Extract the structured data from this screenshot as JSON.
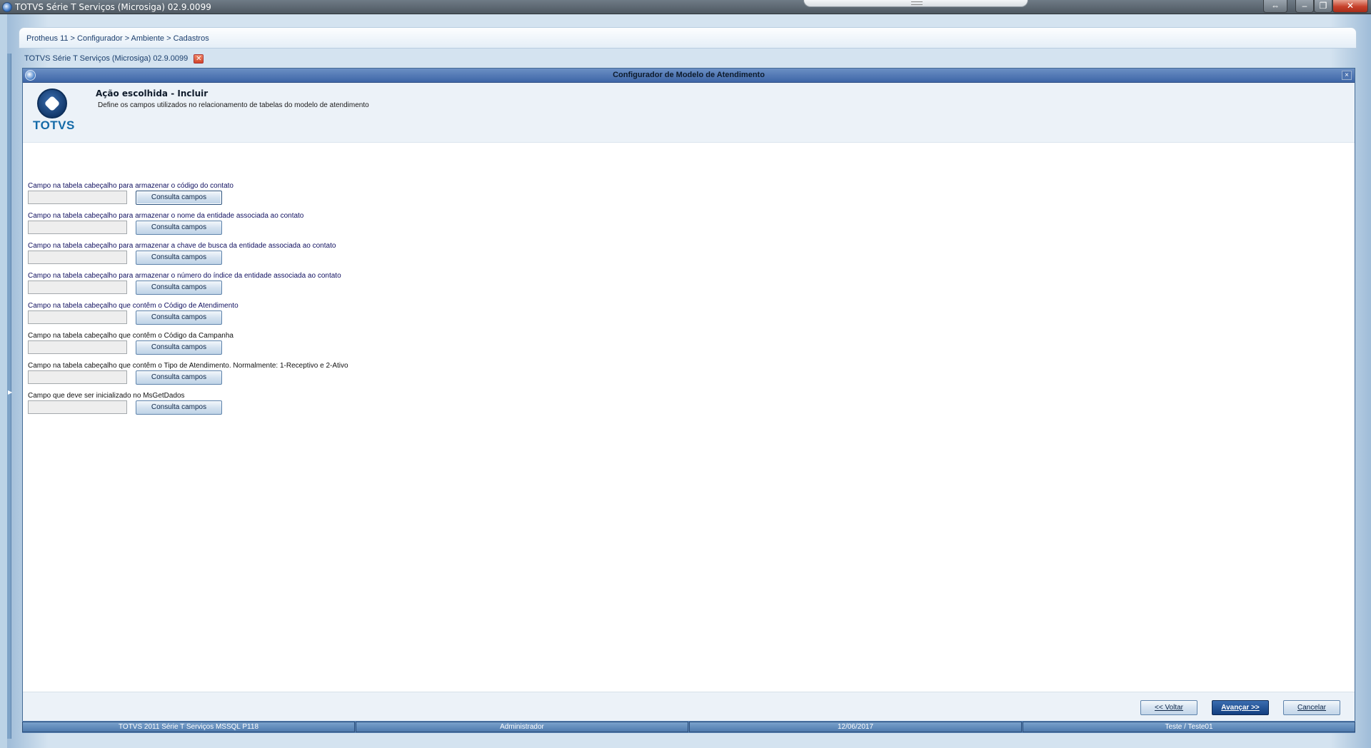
{
  "window": {
    "title": "TOTVS Série T Serviços (Microsiga) 02.9.0099"
  },
  "breadcrumb": "Protheus 11 > Configurador > Ambiente > Cadastros",
  "tab": {
    "label": "TOTVS Série T Serviços (Microsiga) 02.9.0099",
    "close_glyph": "✕"
  },
  "dialog": {
    "title": "Configurador de Modelo de Atendimento",
    "close_glyph": "×",
    "header_title": "Ação escolhida - Incluir",
    "header_subtitle": "Define os campos utilizados no relacionamento de tabelas do modelo de atendimento",
    "logo_text": "TOTVS"
  },
  "fields": [
    {
      "label": "Campo na tabela cabeçalho para armazenar o código do contato",
      "value": "",
      "button": "Consulta campos"
    },
    {
      "label": "Campo na tabela cabeçalho para armazenar o nome da entidade associada ao contato",
      "value": "",
      "button": "Consulta campos"
    },
    {
      "label": "Campo na tabela cabeçalho para armazenar a chave de busca da entidade associada ao contato",
      "value": "",
      "button": "Consulta campos"
    },
    {
      "label": "Campo na tabela cabeçalho para armazenar o número do índice da entidade associada ao contato",
      "value": "",
      "button": "Consulta campos"
    },
    {
      "label": "Campo na tabela cabeçalho que contêm o Código de Atendimento",
      "value": "",
      "button": "Consulta campos"
    },
    {
      "label": "Campo na tabela cabeçalho que contêm o Código da Campanha",
      "value": "",
      "button": "Consulta campos"
    },
    {
      "label": "Campo na tabela cabeçalho que contêm o Tipo de Atendimento. Normalmente: 1-Receptivo e 2-Ativo",
      "value": "",
      "button": "Consulta campos"
    },
    {
      "label": "Campo que deve ser inicializado no MsGetDados",
      "value": "",
      "button": "Consulta campos"
    }
  ],
  "nav": {
    "back": "<< Voltar",
    "next": "Avançar >>",
    "cancel": "Cancelar"
  },
  "status_bar": {
    "system": "TOTVS 2011 Série T Serviços MSSQL P118",
    "user": "Administrador",
    "date": "12/06/2017",
    "environment": "Teste / Teste01"
  },
  "colors": {
    "dialog_titlebar": "#3e66a7",
    "accent_button": "#133f80",
    "status_bar": "#5c86b8"
  }
}
